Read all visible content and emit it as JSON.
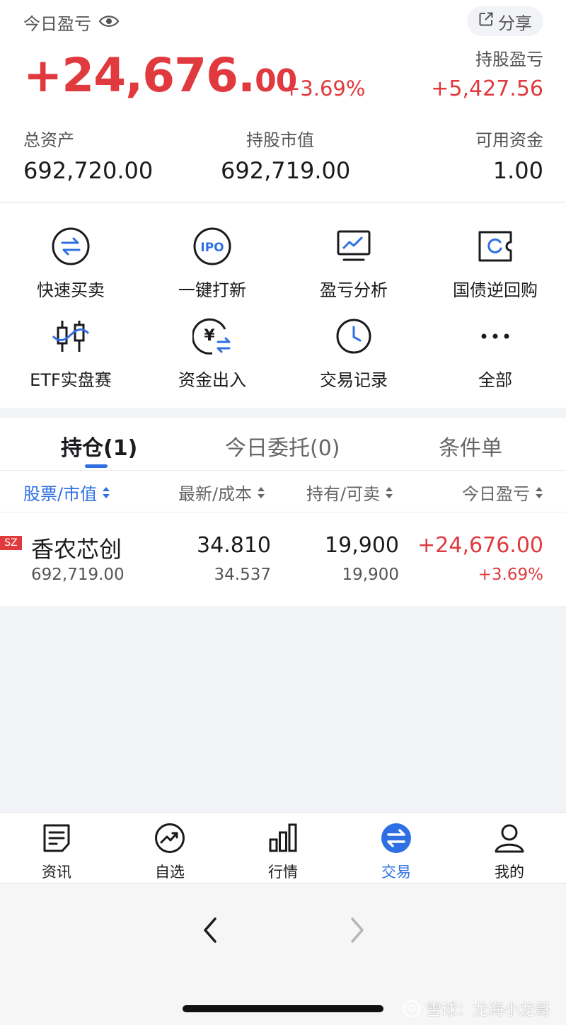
{
  "summary": {
    "today_pl_label": "今日盈亏",
    "share_label": "分享",
    "today_pl_main": "+24,676.",
    "today_pl_cents": "00",
    "today_pl_pct": "+3.69%",
    "holding_pl_label": "持股盈亏",
    "holding_pl_value": "+5,427.56",
    "total_assets_label": "总资产",
    "total_assets_value": "692,720.00",
    "market_value_label": "持股市值",
    "market_value_value": "692,719.00",
    "available_cash_label": "可用资金",
    "available_cash_value": "1.00"
  },
  "tools": [
    {
      "label": "快速买卖",
      "icon": "swap-icon"
    },
    {
      "label": "一键打新",
      "icon": "ipo-icon"
    },
    {
      "label": "盈亏分析",
      "icon": "monitor-chart-icon"
    },
    {
      "label": "国债逆回购",
      "icon": "ticket-refresh-icon"
    },
    {
      "label": "ETF实盘赛",
      "icon": "candlestick-icon"
    },
    {
      "label": "资金出入",
      "icon": "yuan-transfer-icon"
    },
    {
      "label": "交易记录",
      "icon": "clock-icon"
    },
    {
      "label": "全部",
      "icon": "more-dots-icon"
    }
  ],
  "holdings": {
    "tabs": [
      "持仓(1)",
      "今日委托(0)",
      "条件单"
    ],
    "columns": [
      "股票/市值",
      "最新/成本",
      "持有/可卖",
      "今日盈亏"
    ],
    "rows": [
      {
        "market": "SZ",
        "name": "香农芯创",
        "market_value": "692,719.00",
        "latest": "34.810",
        "cost": "34.537",
        "hold": "19,900",
        "sellable": "19,900",
        "pl": "+24,676.00",
        "pl_pct": "+3.69%"
      }
    ]
  },
  "tabbar": [
    {
      "label": "资讯",
      "icon": "news-icon"
    },
    {
      "label": "自选",
      "icon": "trend-icon"
    },
    {
      "label": "行情",
      "icon": "bar-chart-icon"
    },
    {
      "label": "交易",
      "icon": "trade-icon",
      "active": true
    },
    {
      "label": "我的",
      "icon": "person-icon"
    }
  ],
  "watermark": "雪球：龙海小龙哥",
  "colors": {
    "up_red": "#e0393e",
    "accent_blue": "#2f6fe4"
  }
}
